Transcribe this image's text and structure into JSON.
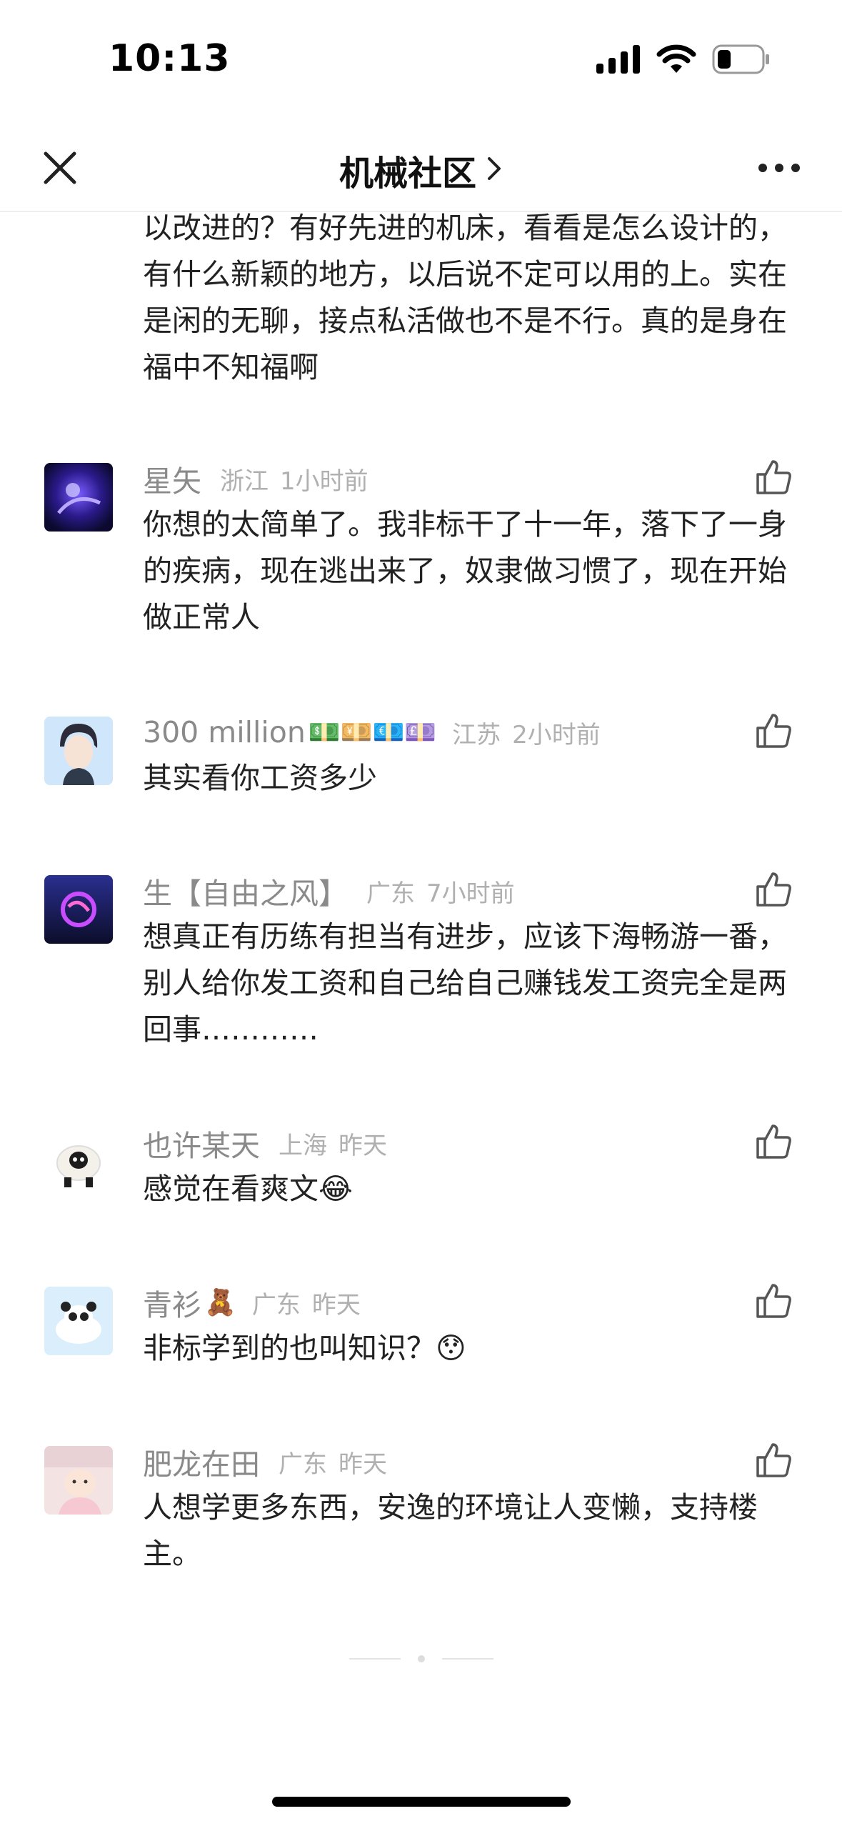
{
  "status_bar": {
    "time": "10:13",
    "icons": [
      "cellular-signal-icon",
      "wifi-icon",
      "battery-icon"
    ]
  },
  "nav": {
    "title": "机械社区",
    "close_icon": "close-icon",
    "chevron_icon": "chevron-right-icon",
    "more_icon": "more-icon"
  },
  "thread": {
    "continued_text": "以改进的？有好先进的机床，看看是怎么设计的，有什么新颖的地方，以后说不定可以用的上。实在是闲的无聊，接点私活做也不是不行。真的是身在福中不知福啊",
    "comments": [
      {
        "username": "星矢",
        "username_emoji": "",
        "location": "浙江",
        "time": "1小时前",
        "text": "你想的太简单了。我非标干了十一年，落下了一身的疾病，现在逃出来了，奴隶做习惯了，现在开始做正常人"
      },
      {
        "username": "300 million",
        "username_emoji": "💵💴💶💷",
        "location": "江苏",
        "time": "2小时前",
        "text": "其实看你工资多少"
      },
      {
        "username": "生【自由之风】",
        "username_emoji": "",
        "location": "广东",
        "time": "7小时前",
        "text": "想真正有历练有担当有进步，应该下海畅游一番，别人给你发工资和自己给自己赚钱发工资完全是两回事…………"
      },
      {
        "username": "也许某天",
        "username_emoji": "",
        "location": "上海",
        "time": "昨天",
        "text": "感觉在看爽文😂"
      },
      {
        "username": "青衫",
        "username_emoji": "🧸",
        "location": "广东",
        "time": "昨天",
        "text": "非标学到的也叫知识？😯"
      },
      {
        "username": "肥龙在田",
        "username_emoji": "",
        "location": "广东",
        "time": "昨天",
        "text": "人想学更多东西，安逸的环境让人变懒，支持楼主。"
      }
    ]
  },
  "colors": {
    "text_primary": "#222222",
    "username": "#8a8a8a",
    "meta": "#b0b0b0",
    "divider": "#eeeeee"
  }
}
